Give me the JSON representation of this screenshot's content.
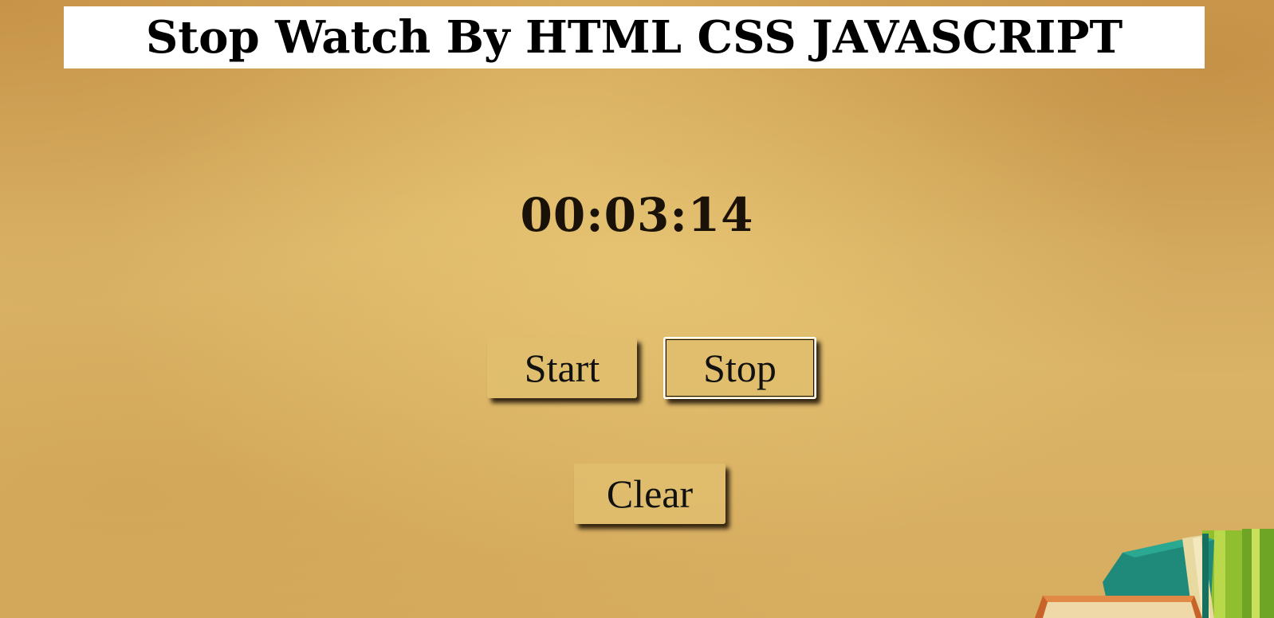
{
  "page": {
    "title": "Stop Watch By HTML CSS JAVASCRIPT"
  },
  "stopwatch": {
    "time": "00:03:14"
  },
  "controls": {
    "start_label": "Start",
    "stop_label": "Stop",
    "clear_label": "Clear"
  },
  "colors": {
    "background": "#dcb66a",
    "title_background": "#ffffff",
    "text": "#000000",
    "book_teal": "#1f8a7a",
    "book_green": "#8fbf2f",
    "book_orange": "#c8642a"
  },
  "decor": {
    "icon": "books-illustration"
  }
}
